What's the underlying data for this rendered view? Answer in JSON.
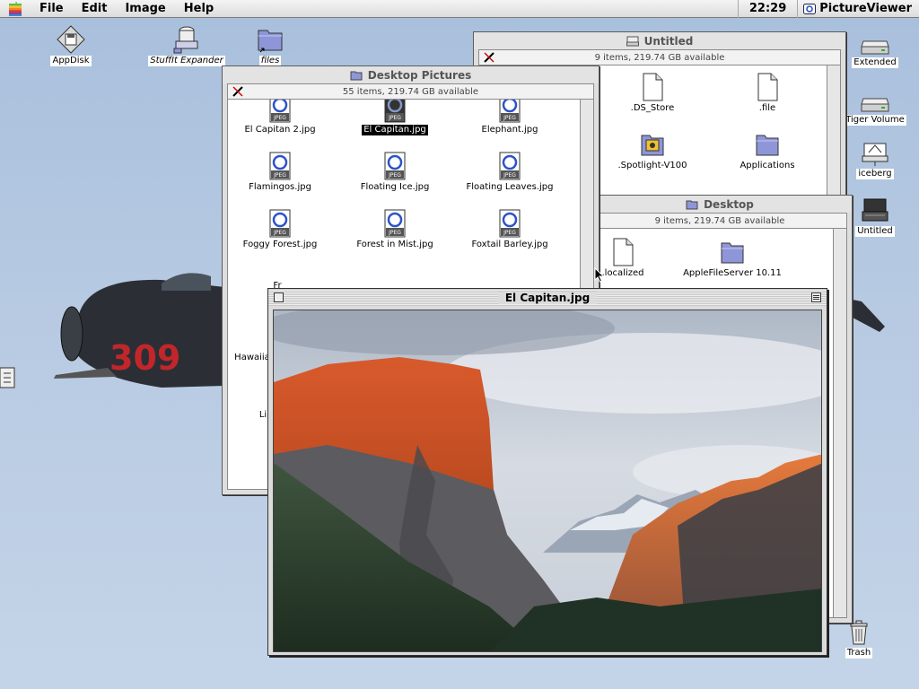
{
  "menubar": {
    "menus": [
      "File",
      "Edit",
      "Image",
      "Help"
    ],
    "clock": "22:29",
    "app_name": "PictureViewer"
  },
  "desktop_icons": {
    "appdisk": "AppDisk",
    "stuffit": "StuffIt Expander",
    "files": "files",
    "extended": "Extended",
    "tiger": "Tiger Volume",
    "iceberg": "iceberg",
    "untitled": "Untitled",
    "trash": "Trash"
  },
  "untitled_window": {
    "title": "Untitled",
    "info": "9 items, 219.74 GB available",
    "items": [
      ".DS_Store",
      ".file",
      ".Spotlight-V100",
      "Applications"
    ]
  },
  "desktop_window": {
    "title": "Desktop",
    "info": "9 items, 219.74 GB available",
    "items": [
      ".localized",
      "AppleFileServer 10.11"
    ]
  },
  "pictures_window": {
    "title": "Desktop Pictures",
    "info": "55 items, 219.74 GB available",
    "items": [
      "El Capitan 2.jpg",
      "El Capitan.jpg",
      "Elephant.jpg",
      "Flamingos.jpg",
      "Floating Ice.jpg",
      "Floating Leaves.jpg",
      "Foggy Forest.jpg",
      "Forest in Mist.jpg",
      "Foxtail Barley.jpg"
    ],
    "partial_labels": [
      "Fr",
      "Hawaiia",
      "Li"
    ],
    "selected": "El Capitan.jpg",
    "file_badge": "JPEG"
  },
  "viewer": {
    "title": "El Capitan.jpg"
  },
  "colors": {
    "desktop": "#b7cae2",
    "folder": "#8e96d8",
    "selection": "#000000"
  }
}
